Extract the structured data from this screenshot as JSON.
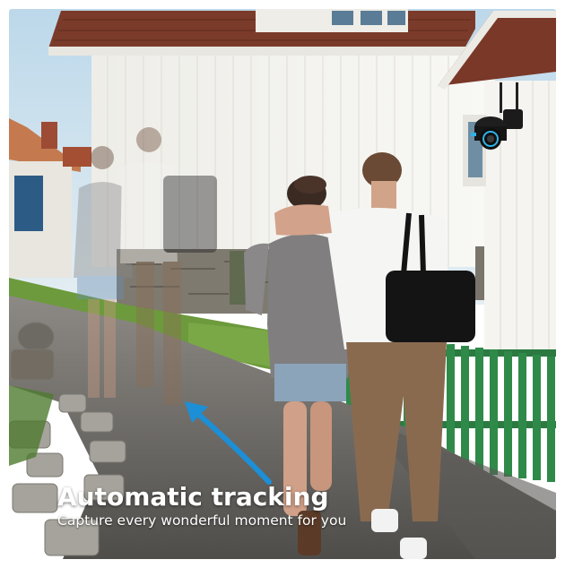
{
  "promo": {
    "headline": "Automatic tracking",
    "subline": "Capture every wonderful moment for you"
  },
  "colors": {
    "sky": "#cfe2ee",
    "house_wall": "#f3f2ee",
    "roof": "#7b3b2a",
    "grass": "#6c9a3c",
    "fence": "#2f8a49",
    "path": "#6d6b68",
    "tracking_arrow": "#1c8fd6",
    "camera_ring": "#2fb2e6"
  }
}
